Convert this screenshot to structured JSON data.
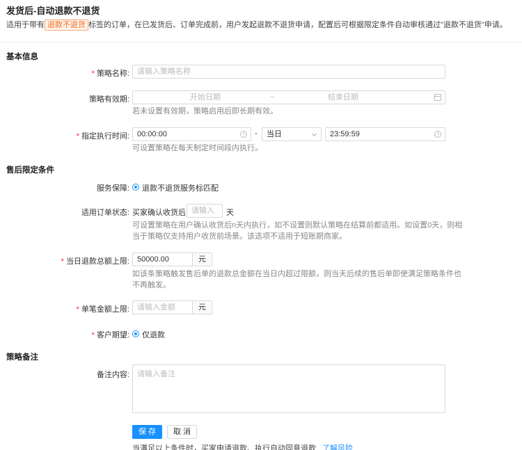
{
  "header": {
    "title": "发货后-自动退款不退货",
    "desc_prefix": "适用于带有",
    "tag": "退款不退货",
    "desc_suffix": "标签的订单，在已发货后、订单完成前，用户发起退款不退货申请，配置后可根据限定条件自动审核通过\"退款不退货\"申请。"
  },
  "basic": {
    "section_title": "基本信息",
    "name_label": "策略名称:",
    "name_placeholder": "请输入策略名称",
    "validity_label": "策略有效期:",
    "start_placeholder": "开始日期",
    "range_sep": "~",
    "end_placeholder": "结束日期",
    "validity_hint": "若未设置有效期，策略启用后即长期有效。",
    "time_label": "指定执行时间:",
    "time_start": "00:00:00",
    "dash": "-",
    "day_select": "当日",
    "time_end": "23:59:59",
    "time_hint": "可设置策略在每天制定时间段内执行。"
  },
  "after_sale": {
    "section_title": "售后限定条件",
    "service_label": "服务保障:",
    "service_option": "退款不退货服务标匹配",
    "order_status_label": "适用订单状态:",
    "order_status_prefix": "买家确认收货后",
    "days_placeholder": "请输入",
    "days_unit": "天",
    "order_status_hint_1": "可设置策略在用户确认收货后n天内执行，如不设置则默认策略在结算前都适用。如设置0天，则相",
    "order_status_hint_2": "当于策略仅支持用户收货前场景。该选项不适用于短账期商家。",
    "daily_limit_label": "当日退款总额上限:",
    "daily_limit_value": "50000.00",
    "currency": "元",
    "daily_hint_1": "如该条策略触发售后单的退款总金额在当日内超过限额，则当天后续的售后单即使满足策略条件也",
    "daily_hint_2": "不再触发。",
    "single_limit_label": "单笔金额上限:",
    "single_limit_placeholder": "请输入金额",
    "expectation_label": "客户期望:",
    "expectation_option": "仅退款"
  },
  "remark": {
    "section_title": "策略备注",
    "label": "备注内容:",
    "placeholder": "请输入备注"
  },
  "actions": {
    "save": "保 存",
    "cancel": "取 消",
    "footer_text": "当满足以上条件时，买家申请退款、执行自动同意退款",
    "risk_link": "了解风险"
  },
  "colors": {
    "primary": "#1890ff",
    "required": "#f5222d",
    "tag": "#f56a1f"
  }
}
